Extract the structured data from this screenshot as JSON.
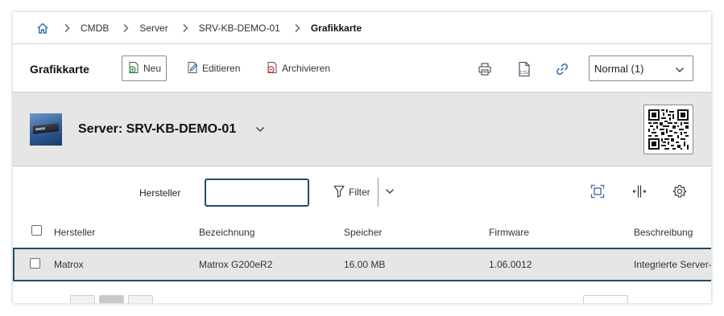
{
  "breadcrumb": {
    "home_icon": "home-icon",
    "items": [
      "CMDB",
      "Server",
      "SRV-KB-DEMO-01",
      "Grafikkarte"
    ]
  },
  "toolbar": {
    "title": "Grafikkarte",
    "new_label": "Neu",
    "edit_label": "Editieren",
    "archive_label": "Archivieren",
    "icons": [
      "print-icon",
      "csv-export-icon",
      "link-icon"
    ],
    "view_select": "Normal (1)"
  },
  "object": {
    "title": "Server: SRV-KB-DEMO-01",
    "thumbnail": "server-thumbnail",
    "qr": "qr-code"
  },
  "filter": {
    "label": "Hersteller",
    "value": "",
    "filter_label": "Filter"
  },
  "table": {
    "columns": [
      "Hersteller",
      "Bezeichnung",
      "Speicher",
      "Firmware",
      "Beschreibung"
    ],
    "rows": [
      [
        "Matrox",
        "Matrox G200eR2",
        "16.00 MB",
        "1.06.0012",
        "Integrierte Server-"
      ]
    ]
  },
  "colors": {
    "accent": "#1d4f66",
    "header_bg": "#e6e6e6",
    "link_blue": "#3b78c2"
  }
}
